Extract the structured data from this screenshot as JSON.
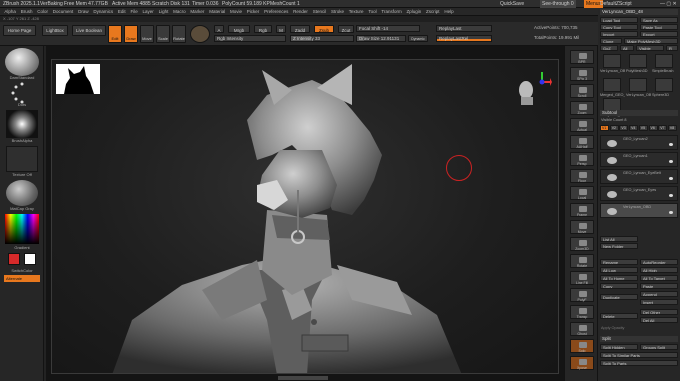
{
  "titlebar": {
    "app": "ZBrush 2025.1.1",
    "doc": "VerBaking",
    "stats": [
      "Free Mem 47.77GB",
      "Active Mem 4885",
      "Scratch Disk 131",
      "Timer 0.036",
      "PolyCount 59.189 KP",
      "MeshCount 1"
    ],
    "quicksave": "QuickSave",
    "seethrough": "See-through 0",
    "menus": "Menus",
    "script": "DefaultZScript"
  },
  "menubar": [
    "Alpha",
    "Brush",
    "Color",
    "Document",
    "Draw",
    "Dynamics",
    "Edit",
    "File",
    "Layer",
    "Light",
    "Macro",
    "Marker",
    "Material",
    "Movie",
    "Picker",
    "Preferences",
    "Render",
    "Stencil",
    "Stroke",
    "Texture",
    "Tool",
    "Transform",
    "Zplugin",
    "Zscript",
    "Help"
  ],
  "infobar": "X -107  Y 261  Z -428",
  "toolbar": {
    "homepage": "Home Page",
    "lightbox": "LightBox",
    "liveboolean": "Live Boolean",
    "edit": "Edit",
    "draw": "Draw",
    "move": "Move",
    "scale": "Scale",
    "rotate": "Rotate",
    "a_label": "A",
    "mrgb": "Mrgb",
    "rgb": "Rgb",
    "m": "M",
    "rgb_intensity": "Rgb Intensity",
    "zadd": "Zadd",
    "zsub": "Zsub",
    "zcut": "Zcut",
    "z_intensity": "Z Intensity 33",
    "focal_shift": "Focal Shift -14",
    "draw_size": "Draw Size 12.91131",
    "dynamic": "Dynamic",
    "replaylast": "ReplayLast",
    "replaylastrel": "ReplayLastRel",
    "active_points": "ActivePoints: 700,735",
    "total_points": "TotalPoints: 19.991 Mil"
  },
  "leftshelf": {
    "brush": "DamStandard",
    "dots": "Dots",
    "stroke": "BrushAlpha",
    "texture": "Texture Off",
    "material": "MatCap Gray",
    "gradient": "Gradient",
    "switchcolor": "SwitchColor",
    "alternate": "Alternate",
    "colors": {
      "primary": "#d62a2a",
      "secondary": "#ffffff"
    }
  },
  "rightshelf": [
    "BPR",
    "SPix 3",
    "Scroll",
    "Zoom",
    "Actual",
    "AAHalf",
    "Persp",
    "Floor",
    "Local",
    "Frame",
    "Move",
    "Zoom3D",
    "Rotate",
    "Line Fill",
    "PolyF",
    "Transp",
    "Ghost",
    "Solo",
    "Xpose"
  ],
  "panel": {
    "title": "VerLyncan_OBD_48",
    "load": "Load Tool",
    "save": "Save As",
    "copy": "Copy Tool",
    "paste": "Paste Tool",
    "import": "Import",
    "export": "Export",
    "clone": "Clone",
    "make": "Make PolyMesh3D",
    "goz": "GoZ",
    "all": "All",
    "visible": "Visible",
    "r": "R",
    "tools": [
      "VerLyncan_OBD",
      "PolyMesh3D",
      "SimpleBrush",
      "Merged_GEO_Ly",
      "VerLyncan_OBD",
      "Sphere3D",
      "VerLyncan_OBD"
    ],
    "subtool_header": "Subtool",
    "visible_count": "Visible Count 8",
    "v_labels": [
      "V1",
      "V2",
      "V3",
      "V4",
      "V5",
      "V6",
      "V7",
      "V8"
    ],
    "subtools": [
      "GEO_Lyncan2",
      "GEO_Lyncan1",
      "GEO_Lyncan_EyeBelt",
      "GEO_Lyncan_Eyes",
      "VerLyncan_OBD"
    ],
    "list_all": "List All",
    "new_folder": "New Folder",
    "rename": "Rename",
    "autoreorder": "AutoReorder",
    "all_low": "All Low",
    "all_high": "All High",
    "all_to_home": "All To Home",
    "all_to_target": "All To Target",
    "copy2": "Copy",
    "paste2": "Paste",
    "duplicate": "Duplicate",
    "append": "Append",
    "insert": "Insert",
    "delete": "Delete",
    "del_other": "Del Other",
    "del_all": "Del All",
    "apply_opacity": "Apply Opacity",
    "split_header": "Split",
    "split_hidden": "Split Hidden",
    "groups_split": "Groups Split",
    "split_similar": "Split To Similar Parts",
    "split_parts": "Split To Parts"
  }
}
